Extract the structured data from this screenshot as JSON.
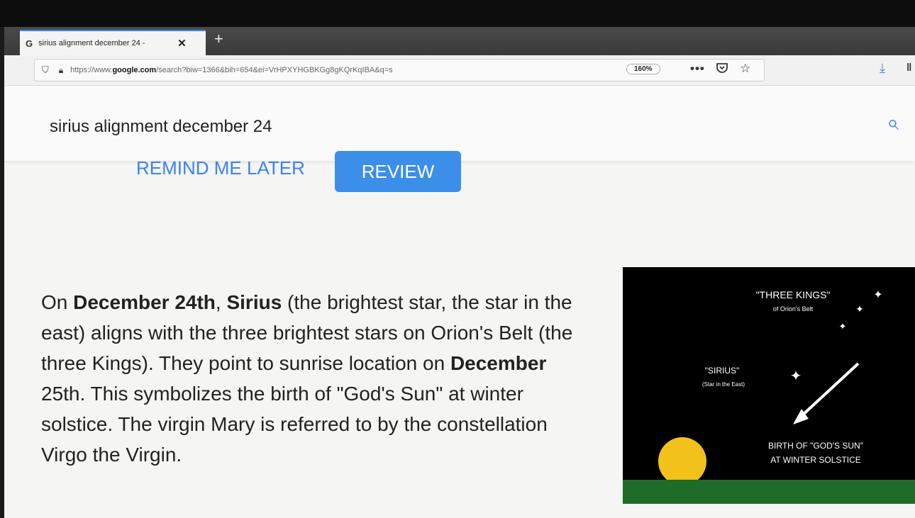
{
  "browser": {
    "tab": {
      "favicon": "G",
      "title": "sirius alignment december 24 -",
      "close_glyph": "✕"
    },
    "new_tab_glyph": "+",
    "url_prefix": "https://www.",
    "url_domain": "google.com",
    "url_rest": "/search?biw=1366&bih=654&ei=VrHPXYHGBKGg8gKQrKqIBA&q=s",
    "zoom": "160%",
    "icons": [
      "shield-icon",
      "lock-icon",
      "more-icon",
      "pocket-icon",
      "star-icon",
      "download-icon",
      "library-icon"
    ]
  },
  "search": {
    "query": "sirius alignment december 24"
  },
  "prompt": {
    "remind_label": "REMIND ME LATER",
    "review_label": "REVIEW"
  },
  "snippet": {
    "t1": "On ",
    "b1": "December 24th",
    "t2": ", ",
    "b2": "Sirius",
    "t3": " (the brightest star, the star in the east) aligns with the three brightest stars on Orion's Belt (the three Kings). They point to sunrise location on ",
    "b3": "December",
    "t4": " 25th. This symbolizes the birth of \"God's Sun\" at winter solstice. The virgin Mary is referred to by the constellation Virgo the Virgin."
  },
  "figure": {
    "kings_title": "\"THREE KINGS\"",
    "kings_sub": "of Orion's Belt",
    "sirius_title": "\"SIRIUS\"",
    "sirius_sub": "(Star in the East)",
    "birth_line1": "BIRTH OF \"GOD'S SUN\"",
    "birth_line2": "AT WINTER SOLSTICE"
  },
  "colors": {
    "accent": "#3b8fe8",
    "sun": "#f2c21b",
    "ground": "#1f6b2a"
  }
}
